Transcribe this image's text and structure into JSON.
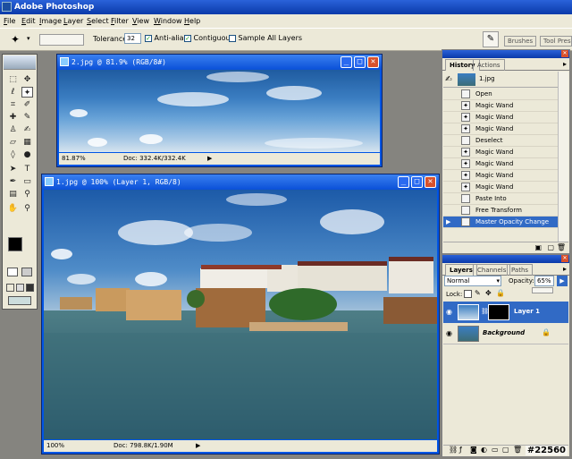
{
  "app": {
    "title": "Adobe Photoshop"
  },
  "menu": [
    "File",
    "Edit",
    "Image",
    "Layer",
    "Select",
    "Filter",
    "View",
    "Window",
    "Help"
  ],
  "options": {
    "tolerance_label": "Tolerance:",
    "tolerance_value": "32",
    "anti_alias": "Anti-alias",
    "contiguous": "Contiguous",
    "sample_all": "Sample All Layers",
    "brushes_tab": "Brushes",
    "tool_presets_tab": "Tool Prese"
  },
  "doc2": {
    "title": "2.jpg @ 81.9% (RGB/8#)",
    "zoom": "81.87%",
    "info": "Doc: 332.4K/332.4K"
  },
  "doc1": {
    "title": "1.jpg @ 100% (Layer 1, RGB/8)",
    "zoom": "100%",
    "info": "Doc: 798.8K/1.90M"
  },
  "history": {
    "tab_history": "History",
    "tab_actions": "Actions",
    "snapshot": "1.jpg",
    "items": [
      "Open",
      "Magic Wand",
      "Magic Wand",
      "Magic Wand",
      "Deselect",
      "Magic Wand",
      "Magic Wand",
      "Magic Wand",
      "Magic Wand",
      "Paste Into",
      "Free Transform",
      "Master Opacity Change"
    ]
  },
  "layers": {
    "tab_layers": "Layers",
    "tab_channels": "Channels",
    "tab_paths": "Paths",
    "blend": "Normal",
    "opacity_label": "Opacity:",
    "opacity_value": "65%",
    "lock_label": "Lock:",
    "items": [
      {
        "name": "Layer 1"
      },
      {
        "name": "Background"
      }
    ]
  },
  "watermark": "#22560",
  "colors": {
    "accent": "#0a50d8",
    "selected": "#316ac5",
    "close": "#d8512d",
    "panel": "#ece9d8"
  }
}
